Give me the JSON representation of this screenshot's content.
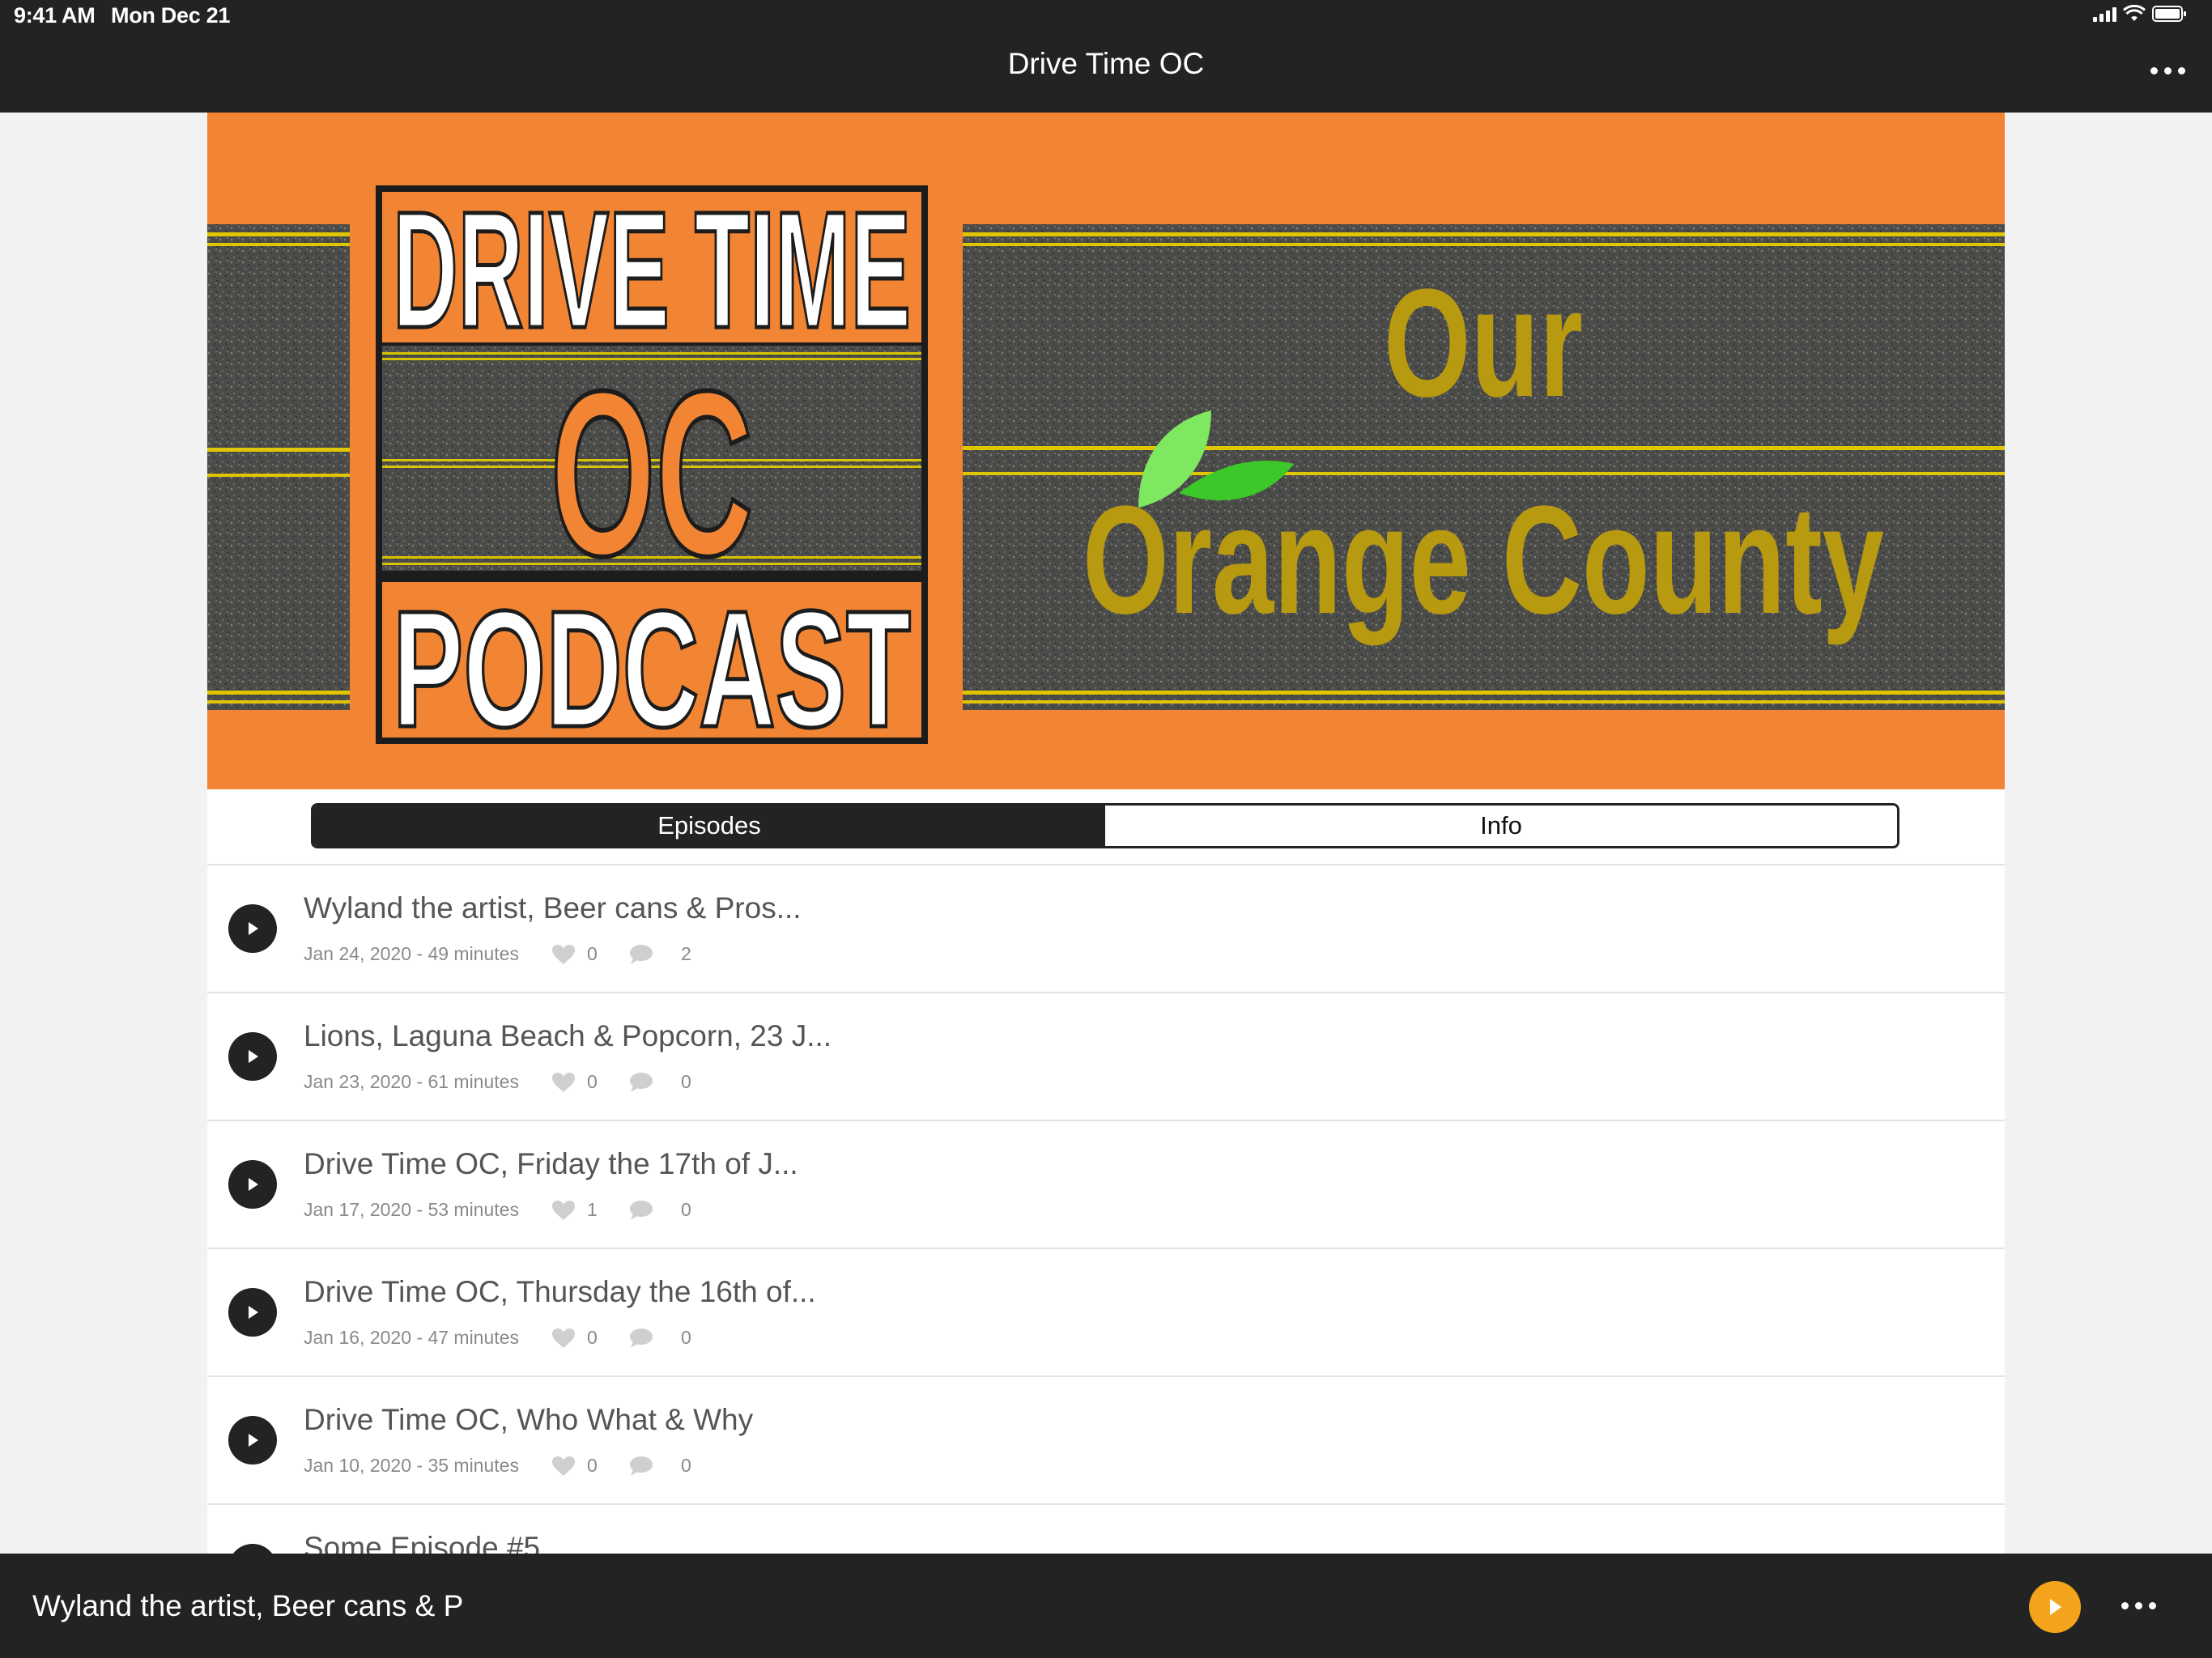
{
  "status_bar": {
    "time": "9:41 AM",
    "date": "Mon Dec 21"
  },
  "nav": {
    "title": "Drive Time OC"
  },
  "banner": {
    "logo_lines": [
      "DRIVE TIME",
      "OC",
      "PODCAST"
    ],
    "tagline_lines": [
      "Our",
      "Orange County"
    ],
    "colors": {
      "orange": "#f28533",
      "asphalt": "#4a4a48",
      "yellow_stripe": "#e0c600",
      "tagline": "#b89a10",
      "leaf": "#52d432"
    }
  },
  "tabs": [
    {
      "label": "Episodes",
      "selected": true
    },
    {
      "label": "Info",
      "selected": false
    }
  ],
  "episodes": [
    {
      "title": "Wyland the artist, Beer cans & Pros...",
      "meta": "Jan 24, 2020 - 49 minutes",
      "likes": "0",
      "comments": "2"
    },
    {
      "title": "Lions, Laguna Beach & Popcorn, 23 J...",
      "meta": "Jan 23, 2020 - 61 minutes",
      "likes": "0",
      "comments": "0"
    },
    {
      "title": "Drive Time OC, Friday the 17th of J...",
      "meta": "Jan 17, 2020 - 53 minutes",
      "likes": "1",
      "comments": "0"
    },
    {
      "title": "Drive Time OC, Thursday the 16th of...",
      "meta": "Jan 16, 2020 - 47 minutes",
      "likes": "0",
      "comments": "0"
    },
    {
      "title": "Drive Time OC, Who What & Why",
      "meta": "Jan 10, 2020 - 35 minutes",
      "likes": "0",
      "comments": "0"
    },
    {
      "title": "Some Episode #5",
      "meta": "",
      "likes": "",
      "comments": ""
    }
  ],
  "player": {
    "now_playing": "Wyland the artist, Beer cans & P",
    "accent": "#f4a41c"
  },
  "icons": {
    "play": "play-icon",
    "like": "heart-icon",
    "comment": "comment-icon",
    "more": "more-horizontal-icon",
    "signal": "cellular-signal-icon",
    "wifi": "wifi-icon",
    "battery": "battery-icon"
  }
}
